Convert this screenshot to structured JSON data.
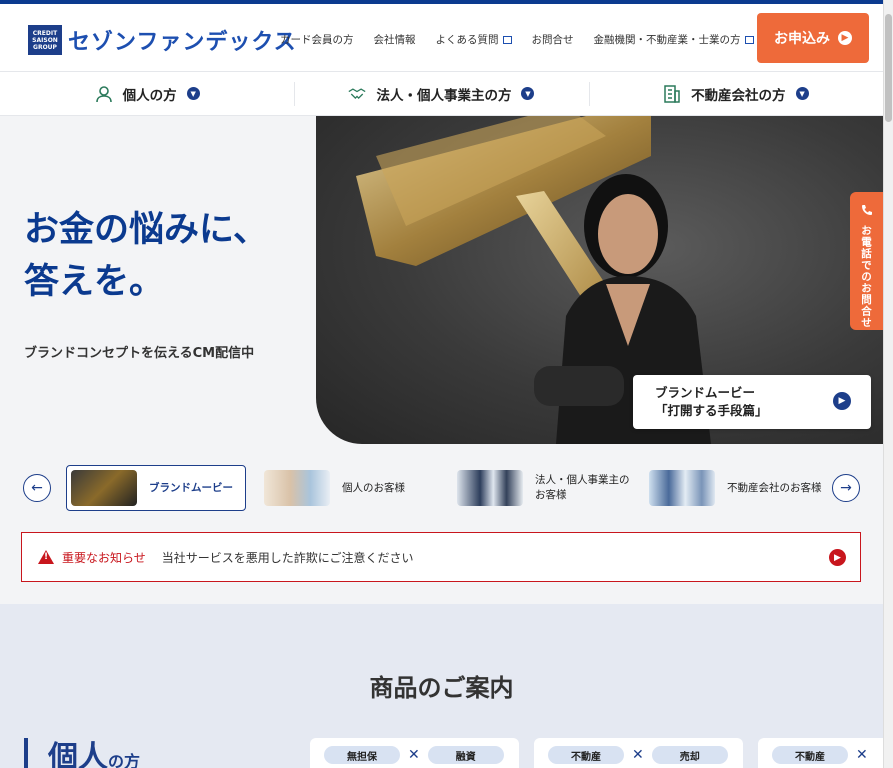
{
  "header": {
    "brand_small": [
      "CREDIT",
      "SAISON",
      "GROUP"
    ],
    "brand_name": "セゾンファンデックス",
    "nav": [
      "カード会員の方",
      "会社情報",
      "よくある質問",
      "お問合せ",
      "金融機関・不動産業・士業の方"
    ],
    "apply_label": "お申込み"
  },
  "categories": [
    "個人の方",
    "法人・個人事業主の方",
    "不動産会社の方"
  ],
  "hero": {
    "title": "お金の悩みに、\n答えを。",
    "subtitle": "ブランドコンセプトを伝えるCM配信中",
    "movie_card_line1": "ブランドムービー",
    "movie_card_line2": "「打開する手段篇」"
  },
  "carousel": {
    "items": [
      "ブランドムービー",
      "個人のお客様",
      "法人・個人事業主の\nお客様",
      "不動産会社のお客様"
    ],
    "active_index": 0
  },
  "notice": {
    "label": "重要なお知らせ",
    "message": "当社サービスを悪用した詐欺にご注意ください"
  },
  "products": {
    "title": "商品のご案内",
    "section_label": "個人",
    "section_suffix": "の方",
    "cards": [
      {
        "tag1": "無担保",
        "tag2": "融資"
      },
      {
        "tag1": "不動産",
        "tag2": "売却"
      },
      {
        "tag1": "不動産",
        "tag2": ""
      }
    ]
  },
  "sidetab": {
    "label": "お電話でのお問合せ"
  },
  "colors": {
    "brand": "#1d3e8a",
    "accent": "#ee6a3a",
    "alert": "#c8161d"
  }
}
